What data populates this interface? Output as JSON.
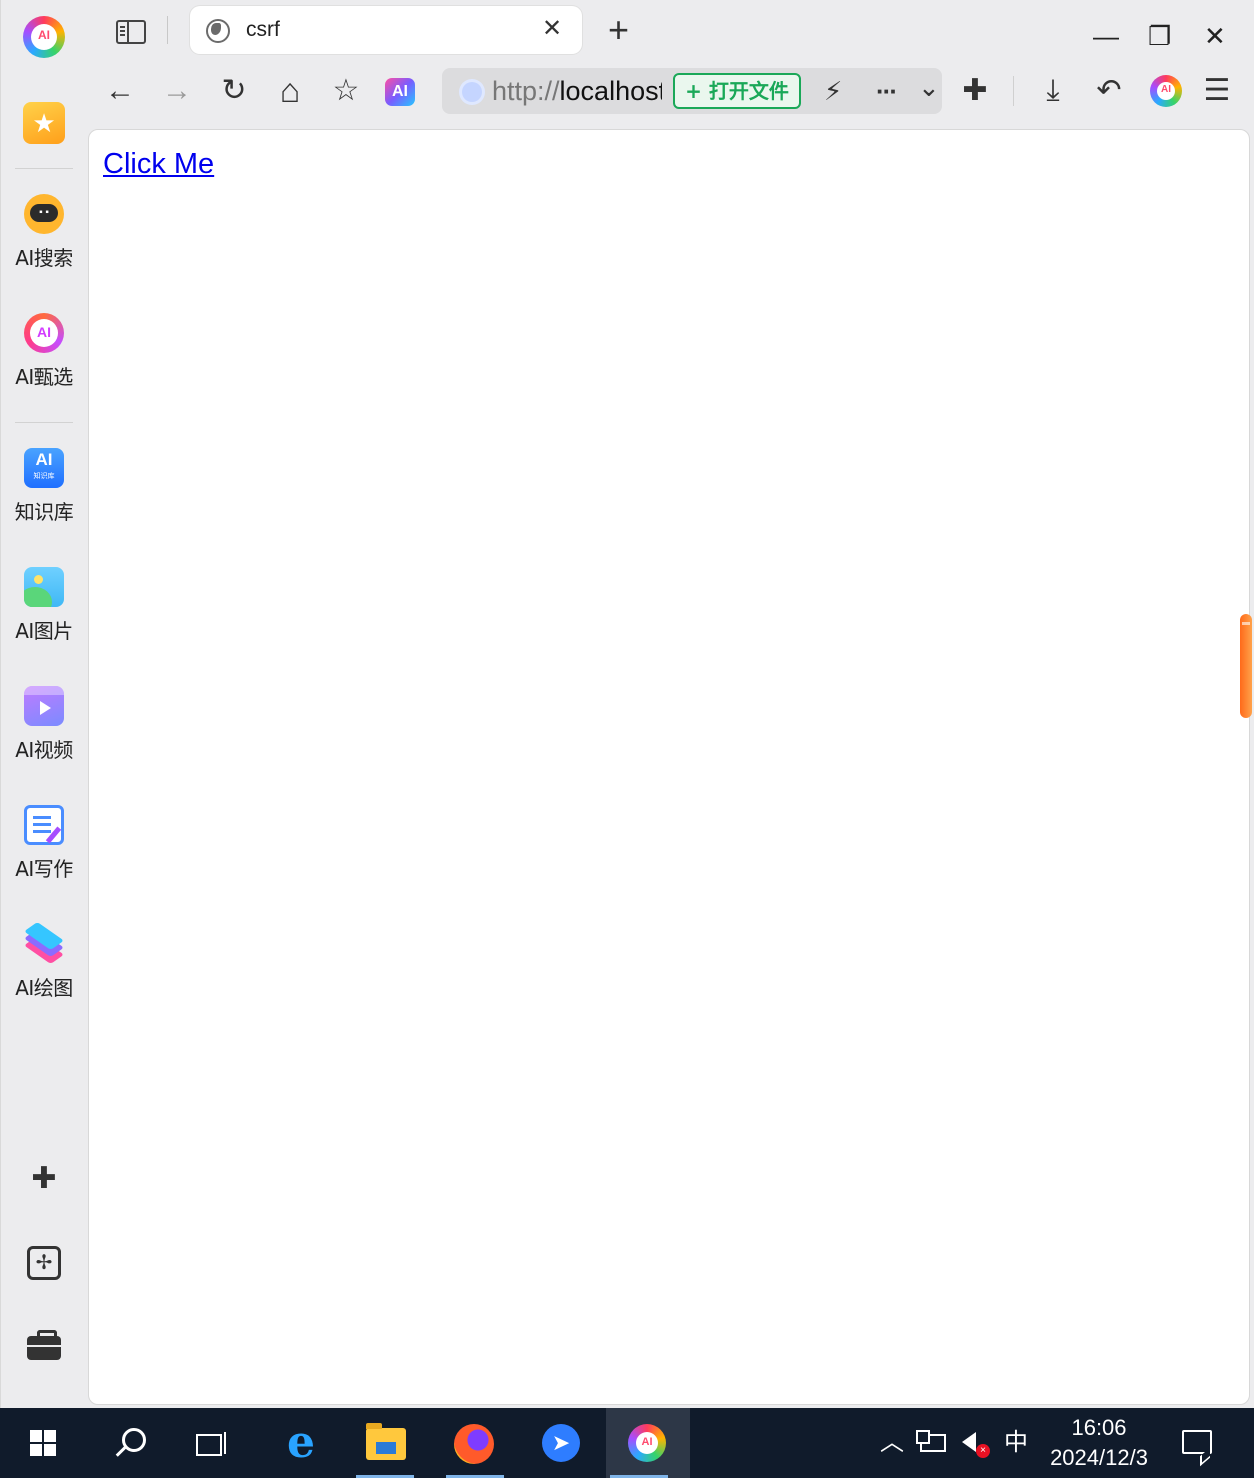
{
  "browser": {
    "logo_text": "AI",
    "tab": {
      "title": "csrf",
      "close_symbol": "✕"
    },
    "new_tab_symbol": "+",
    "window_controls": {
      "minimize": "—",
      "restore": "❐",
      "close": "✕"
    },
    "toolbar": {
      "back": "←",
      "forward": "→",
      "reload": "↻",
      "home": "⌂",
      "favorites": "☆",
      "ai_badge": "AI",
      "url_scheme": "http://",
      "url_host": "localhost",
      "open_file_label": "+ 打开文件",
      "lightning": "⚡",
      "more": "···",
      "dropdown": "⌄",
      "extensions": "✚",
      "download": "⤓",
      "undo": "↶",
      "ai_round": "AI",
      "menu": "☰"
    }
  },
  "sidebar": {
    "favorites_symbol": "★",
    "items": [
      {
        "label": "AI搜索",
        "icon": "robot-icon"
      },
      {
        "label": "AI甄选",
        "icon": "ai-select-icon",
        "icon_text": "AI"
      },
      {
        "label": "知识库",
        "icon": "knowledge-base-icon",
        "icon_text": "AI",
        "icon_subtext": "知识库"
      },
      {
        "label": "AI图片",
        "icon": "image-icon"
      },
      {
        "label": "AI视频",
        "icon": "video-icon"
      },
      {
        "label": "AI写作",
        "icon": "writing-icon"
      },
      {
        "label": "AI绘图",
        "icon": "layers-icon"
      }
    ],
    "bottom_tools": [
      "puzzle-icon",
      "toolbox-icon",
      "briefcase-icon"
    ]
  },
  "page": {
    "link_text": "Click Me"
  },
  "taskbar": {
    "ai_text": "AI",
    "bolt": "➤",
    "tray": {
      "chevron": "︿",
      "ime": "中",
      "time": "16:06",
      "date": "2024/12/3",
      "volume_muted_mark": "×"
    }
  },
  "colors": {
    "accent_green": "#1aa858",
    "link_blue": "#0000ee",
    "taskbar_bg": "#101b2b",
    "scroll_handle": "#ff7a22"
  }
}
